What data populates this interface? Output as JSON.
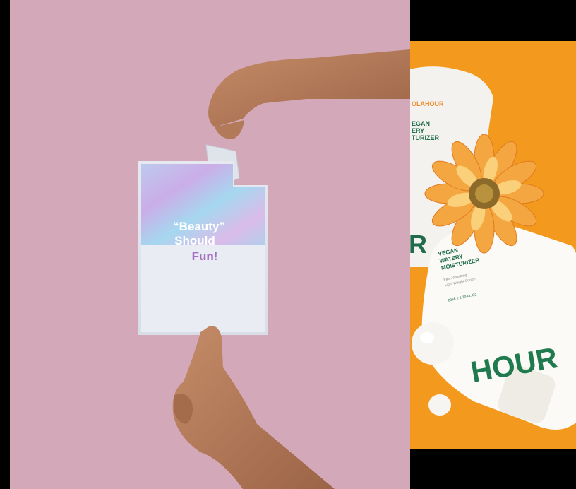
{
  "left_photo": {
    "background_color": "#d3a8b8",
    "pouch_text_line1": "“Beauty”",
    "pouch_text_line2": "Should",
    "pouch_text_line3": "Fun!"
  },
  "right_photo": {
    "background_color": "#f39a1e",
    "brand_top": "OLAHOUR",
    "label_top_1": "EGAN",
    "label_top_2": "ERY",
    "label_top_3": "TURIZER",
    "label_1": "VEGAN",
    "label_2": "WATERY",
    "label_3": "MOISTURIZER",
    "small_1": "Fast Absorbing",
    "small_2": "Light Weight Cream",
    "volume": "80ML / 2.70 FL.OZ.",
    "big_word": "HOUR",
    "partial_letter": "R"
  }
}
